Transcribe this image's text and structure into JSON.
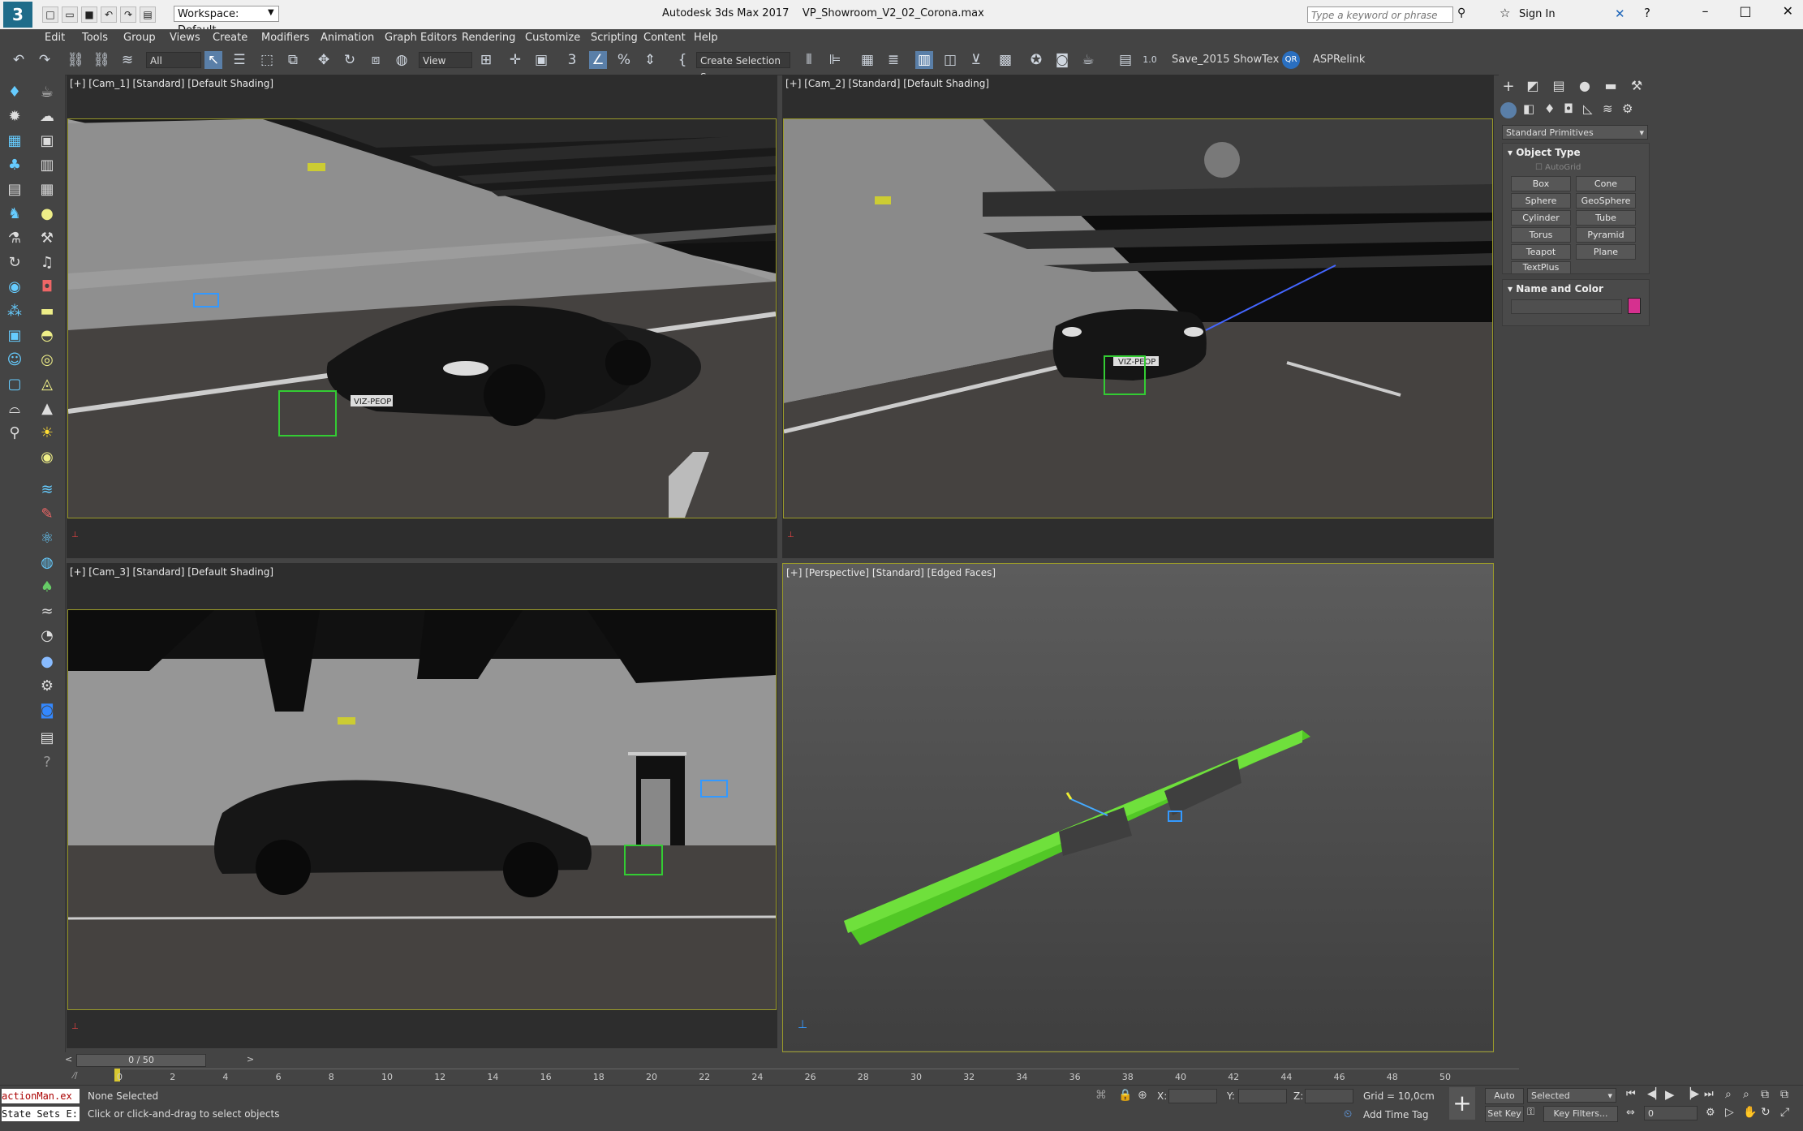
{
  "window": {
    "title": "Autodesk 3ds Max 2017",
    "file": "VP_Showroom_V2_02_Corona.max",
    "workspace": "Workspace: Default",
    "search_placeholder": "Type a keyword or phrase",
    "sign_in": "Sign In"
  },
  "menu": [
    "Edit",
    "Tools",
    "Group",
    "Views",
    "Create",
    "Modifiers",
    "Animation",
    "Graph Editors",
    "Rendering",
    "Customize",
    "Scripting",
    "Content",
    "Help"
  ],
  "toolbar": {
    "filter": "All",
    "ref_coord": "View",
    "selection_set": "Create Selection Se",
    "save_btn": "Save_2015",
    "showtex_btn": "ShowTex",
    "asprelink_btn": "ASPRelink"
  },
  "viewports": [
    {
      "label": "[+] [Cam_1] [Standard] [Default Shading]",
      "plate": "VIZ-PEOP"
    },
    {
      "label": "[+] [Cam_2] [Standard] [Default Shading]",
      "plate": "VIZ-PEOP"
    },
    {
      "label": "[+] [Cam_3] [Standard] [Default Shading]"
    },
    {
      "label": "[+] [Perspective] [Standard] [Edged Faces]"
    }
  ],
  "command_panel": {
    "dropdown": "Standard Primitives",
    "object_type_title": "Object Type",
    "autogrid": "AutoGrid",
    "buttons": [
      "Box",
      "Cone",
      "Sphere",
      "GeoSphere",
      "Cylinder",
      "Tube",
      "Torus",
      "Pyramid",
      "Teapot",
      "Plane",
      "TextPlus"
    ],
    "name_color_title": "Name and Color",
    "object_color": "#d6308f"
  },
  "timeline": {
    "frame": "0 / 50",
    "ticks": [
      "0",
      "2",
      "4",
      "6",
      "8",
      "10",
      "12",
      "14",
      "16",
      "18",
      "20",
      "22",
      "24",
      "26",
      "28",
      "30",
      "32",
      "34",
      "36",
      "38",
      "40",
      "42",
      "44",
      "46",
      "48",
      "50"
    ]
  },
  "status": {
    "listener_top": "actionMan.ex",
    "listener_bottom": "State Sets E:",
    "selection": "None Selected",
    "prompt": "Click or click-and-drag to select objects",
    "x_label": "X:",
    "y_label": "Y:",
    "z_label": "Z:",
    "grid": "Grid = 10,0cm",
    "add_time_tag": "Add Time Tag",
    "auto_key": "Auto Key",
    "set_key": "Set Key",
    "key_mode": "Selected",
    "key_filters": "Key Filters...",
    "current_frame": "0"
  },
  "colors": {
    "ui_bg": "#444444",
    "viewport_border": "#9a9a2a",
    "accent_yellow": "#d9c830",
    "accent_blue": "#2a7fd4"
  }
}
